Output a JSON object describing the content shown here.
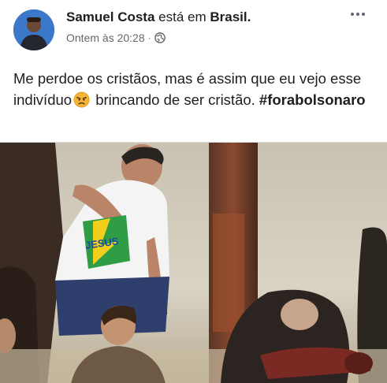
{
  "post": {
    "author": "Samuel Costa",
    "verb": " está em ",
    "location": "Brasil.",
    "timestamp": "Ontem às 20:28",
    "separator": "·",
    "privacy_icon": "globe-icon",
    "text_part1": "Me perdoe os cristãos, mas é assim que eu vejo esse indivíduo",
    "emoji": "angry-face-emoji",
    "text_part2": " brincando de ser cristão. ",
    "hashtag": "#forabolsonaro"
  },
  "image": {
    "description_icon": "photo",
    "shirt_text": "JESUS"
  },
  "colors": {
    "text": "#1c1e21",
    "meta": "#65676b",
    "avatar_bg": "#3b78c9"
  }
}
